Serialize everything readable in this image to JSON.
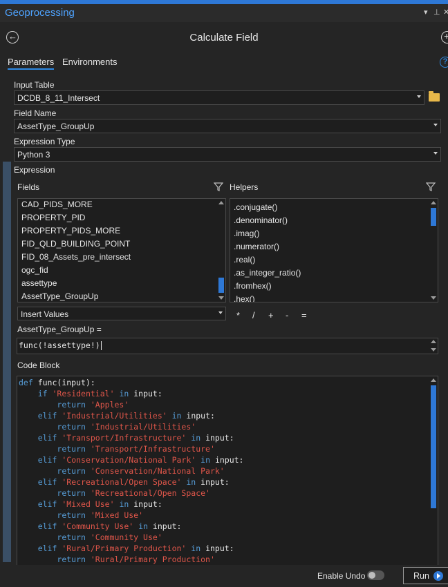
{
  "window": {
    "title": "Geoprocessing",
    "icons": [
      "dropdown-icon",
      "pin-icon",
      "close-icon"
    ]
  },
  "header": {
    "tool_title": "Calculate Field"
  },
  "tabs": [
    {
      "label": "Parameters",
      "active": true
    },
    {
      "label": "Environments",
      "active": false
    }
  ],
  "params": {
    "input_table": {
      "label": "Input Table",
      "value": "DCDB_8_11_Intersect"
    },
    "field_name": {
      "label": "Field Name",
      "value": "AssetType_GroupUp"
    },
    "expression_type": {
      "label": "Expression Type",
      "value": "Python 3"
    }
  },
  "expression": {
    "label": "Expression",
    "fields_label": "Fields",
    "helpers_label": "Helpers",
    "fields": [
      "CAD_PIDS_MORE",
      "PROPERTY_PID",
      "PROPERTY_PIDS_MORE",
      "FID_QLD_BUILDING_POINT",
      "FID_08_Assets_pre_intersect",
      "ogc_fid",
      "assettype",
      "AssetType_GroupUp"
    ],
    "helpers": [
      ".conjugate()",
      ".denominator()",
      ".imag()",
      ".numerator()",
      ".real()",
      ".as_integer_ratio()",
      ".fromhex()",
      ".hex()"
    ],
    "insert_values": "Insert Values",
    "operators": [
      "*",
      "/",
      "+",
      "-",
      "="
    ],
    "target_label": "AssetType_GroupUp =",
    "value": "func(!assettype!)"
  },
  "code_block": {
    "label": "Code Block",
    "lines": [
      {
        "indent": "",
        "parts": [
          {
            "t": "def",
            "c": "kw"
          },
          {
            "t": " func(input):",
            "c": ""
          }
        ]
      },
      {
        "indent": "    ",
        "parts": [
          {
            "t": "if",
            "c": "kw"
          },
          {
            "t": " ",
            "c": ""
          },
          {
            "t": "'Residential'",
            "c": "str"
          },
          {
            "t": " ",
            "c": ""
          },
          {
            "t": "in",
            "c": "kw"
          },
          {
            "t": " input:",
            "c": ""
          }
        ]
      },
      {
        "indent": "        ",
        "parts": [
          {
            "t": "return",
            "c": "kw"
          },
          {
            "t": " ",
            "c": ""
          },
          {
            "t": "'Apples'",
            "c": "str"
          }
        ]
      },
      {
        "indent": "    ",
        "parts": [
          {
            "t": "elif",
            "c": "kw"
          },
          {
            "t": " ",
            "c": ""
          },
          {
            "t": "'Industrial/Utilities'",
            "c": "str"
          },
          {
            "t": " ",
            "c": ""
          },
          {
            "t": "in",
            "c": "kw"
          },
          {
            "t": " input:",
            "c": ""
          }
        ]
      },
      {
        "indent": "        ",
        "parts": [
          {
            "t": "return",
            "c": "kw"
          },
          {
            "t": " ",
            "c": ""
          },
          {
            "t": "'Industrial/Utilities'",
            "c": "str"
          }
        ]
      },
      {
        "indent": "    ",
        "parts": [
          {
            "t": "elif",
            "c": "kw"
          },
          {
            "t": " ",
            "c": ""
          },
          {
            "t": "'Transport/Infrastructure'",
            "c": "str"
          },
          {
            "t": " ",
            "c": ""
          },
          {
            "t": "in",
            "c": "kw"
          },
          {
            "t": " input:",
            "c": ""
          }
        ]
      },
      {
        "indent": "        ",
        "parts": [
          {
            "t": "return",
            "c": "kw"
          },
          {
            "t": " ",
            "c": ""
          },
          {
            "t": "'Transport/Infrastructure'",
            "c": "str"
          }
        ]
      },
      {
        "indent": "    ",
        "parts": [
          {
            "t": "elif",
            "c": "kw"
          },
          {
            "t": " ",
            "c": ""
          },
          {
            "t": "'Conservation/National Park'",
            "c": "str"
          },
          {
            "t": " ",
            "c": ""
          },
          {
            "t": "in",
            "c": "kw"
          },
          {
            "t": " input:",
            "c": ""
          }
        ]
      },
      {
        "indent": "        ",
        "parts": [
          {
            "t": "return",
            "c": "kw"
          },
          {
            "t": " ",
            "c": ""
          },
          {
            "t": "'Conservation/National Park'",
            "c": "str"
          }
        ]
      },
      {
        "indent": "    ",
        "parts": [
          {
            "t": "elif",
            "c": "kw"
          },
          {
            "t": " ",
            "c": ""
          },
          {
            "t": "'Recreational/Open Space'",
            "c": "str"
          },
          {
            "t": " ",
            "c": ""
          },
          {
            "t": "in",
            "c": "kw"
          },
          {
            "t": " input:",
            "c": ""
          }
        ]
      },
      {
        "indent": "        ",
        "parts": [
          {
            "t": "return",
            "c": "kw"
          },
          {
            "t": " ",
            "c": ""
          },
          {
            "t": "'Recreational/Open Space'",
            "c": "str"
          }
        ]
      },
      {
        "indent": "    ",
        "parts": [
          {
            "t": "elif",
            "c": "kw"
          },
          {
            "t": " ",
            "c": ""
          },
          {
            "t": "'Mixed Use'",
            "c": "str"
          },
          {
            "t": " ",
            "c": ""
          },
          {
            "t": "in",
            "c": "kw"
          },
          {
            "t": " input:",
            "c": ""
          }
        ]
      },
      {
        "indent": "        ",
        "parts": [
          {
            "t": "return",
            "c": "kw"
          },
          {
            "t": " ",
            "c": ""
          },
          {
            "t": "'Mixed Use'",
            "c": "str"
          }
        ]
      },
      {
        "indent": "    ",
        "parts": [
          {
            "t": "elif",
            "c": "kw"
          },
          {
            "t": " ",
            "c": ""
          },
          {
            "t": "'Community Use'",
            "c": "str"
          },
          {
            "t": " ",
            "c": ""
          },
          {
            "t": "in",
            "c": "kw"
          },
          {
            "t": " input:",
            "c": ""
          }
        ]
      },
      {
        "indent": "        ",
        "parts": [
          {
            "t": "return",
            "c": "kw"
          },
          {
            "t": " ",
            "c": ""
          },
          {
            "t": "'Community Use'",
            "c": "str"
          }
        ]
      },
      {
        "indent": "    ",
        "parts": [
          {
            "t": "elif",
            "c": "kw"
          },
          {
            "t": " ",
            "c": ""
          },
          {
            "t": "'Rural/Primary Production'",
            "c": "str"
          },
          {
            "t": " ",
            "c": ""
          },
          {
            "t": "in",
            "c": "kw"
          },
          {
            "t": " input:",
            "c": ""
          }
        ]
      },
      {
        "indent": "        ",
        "parts": [
          {
            "t": "return",
            "c": "kw"
          },
          {
            "t": " ",
            "c": ""
          },
          {
            "t": "'Rural/Primary Production'",
            "c": "str"
          }
        ]
      }
    ]
  },
  "footer": {
    "enable_undo_label": "Enable Undo",
    "enable_undo_on": false,
    "run_label": "Run"
  },
  "colors": {
    "accent": "#2e78d6",
    "keyword": "#569cd6",
    "string": "#e0564a",
    "folder": "#e8b84a"
  }
}
